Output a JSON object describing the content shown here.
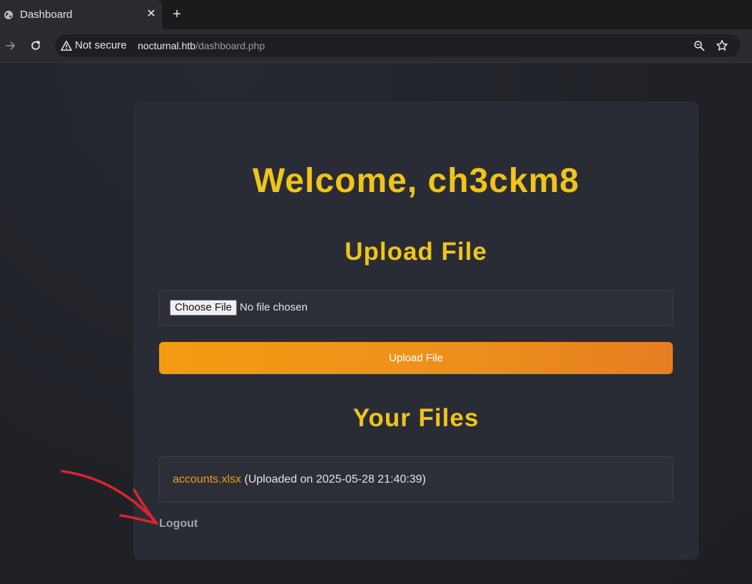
{
  "browser": {
    "tab_title": "Dashboard",
    "close_glyph": "✕",
    "new_tab_glyph": "+",
    "security_label": "Not secure",
    "url_host": "nocturnal.htb",
    "url_path": "/dashboard.php"
  },
  "page": {
    "welcome": "Welcome, ch3ckm8",
    "upload_heading": "Upload File",
    "file_input": {
      "button_label": "Choose File",
      "status": "No file chosen"
    },
    "upload_button": "Upload File",
    "files_heading": "Your Files",
    "files": [
      {
        "name": "accounts.xlsx",
        "meta": " (Uploaded on 2025-05-28 21:40:39)"
      }
    ],
    "logout": "Logout"
  },
  "colors": {
    "heading": "#f0c419",
    "accent": "#f39c12",
    "card": "#2a2c35",
    "annotation": "#d9262c"
  },
  "icons": {
    "tab": "globe-icon",
    "forward": "forward-arrow-icon",
    "reload": "reload-icon",
    "security": "warning-triangle-icon",
    "zoom": "zoom-icon",
    "bookmark": "star-icon"
  }
}
